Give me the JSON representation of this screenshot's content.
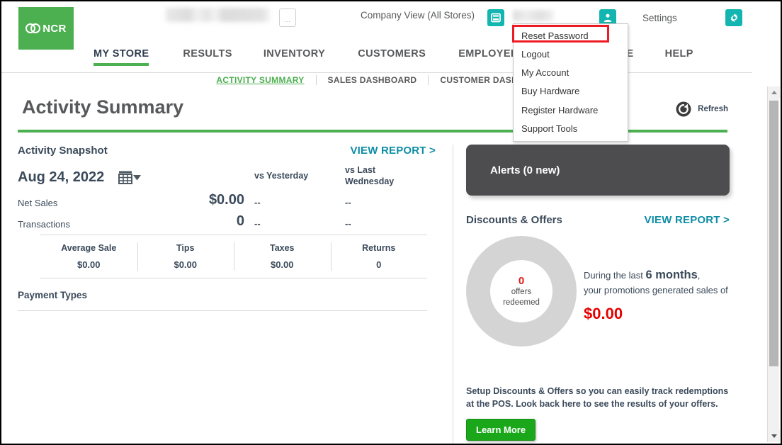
{
  "brand": {
    "logo_text": "NCR",
    "logo_color": "#4caf50"
  },
  "topbar": {
    "ellipsis_label": "...",
    "company_view": "Company View (All Stores)",
    "settings_label": "Settings",
    "store_icon": "store-icon",
    "user_icon": "user-icon",
    "gear_icon": "gear-icon"
  },
  "mainnav": {
    "items": [
      {
        "label": "MY STORE",
        "active": true
      },
      {
        "label": "RESULTS",
        "active": false
      },
      {
        "label": "INVENTORY",
        "active": false
      },
      {
        "label": "CUSTOMERS",
        "active": false
      },
      {
        "label": "EMPLOYEES",
        "active": false
      },
      {
        "label": "MAINTENANCE",
        "active": false
      },
      {
        "label": "HELP",
        "active": false
      }
    ]
  },
  "subnav": {
    "items": [
      {
        "label": "ACTIVITY SUMMARY",
        "active": true
      },
      {
        "label": "SALES DASHBOARD",
        "active": false
      },
      {
        "label": "CUSTOMER DASHBOARD",
        "active": false
      }
    ]
  },
  "page": {
    "title": "Activity Summary",
    "refresh_label": "Refresh",
    "accent_green": "#4caf50"
  },
  "snapshot": {
    "title": "Activity Snapshot",
    "view_report": "VIEW REPORT >",
    "date": "Aug 24, 2022",
    "compare_col_1": "vs Yesterday",
    "compare_col_2": "vs Last Wednesday",
    "rows": [
      {
        "label": "Net Sales",
        "value": "$0.00",
        "vs_yesterday": "--",
        "vs_last": "--"
      },
      {
        "label": "Transactions",
        "value": "0",
        "vs_yesterday": "--",
        "vs_last": "--"
      }
    ],
    "kpis": [
      {
        "name": "Average Sale",
        "value": "$0.00"
      },
      {
        "name": "Tips",
        "value": "$0.00"
      },
      {
        "name": "Taxes",
        "value": "$0.00"
      },
      {
        "name": "Returns",
        "value": "0"
      }
    ],
    "payment_types": "Payment Types"
  },
  "alerts": {
    "title": "Alerts (0 new)"
  },
  "discounts": {
    "title": "Discounts & Offers",
    "view_report": "VIEW REPORT >",
    "donut_number": "0",
    "donut_caption_line1": "offers",
    "donut_caption_line2": "redeemed",
    "promo_prefix": "During the last ",
    "promo_period": "6 months",
    "promo_suffix": ",",
    "promo_line2": "your promotions generated sales of",
    "promo_amount": "$0.00",
    "promo_amount_color": "#e80000",
    "setup_line1": "Setup Discounts & Offers so you can easily track redemptions",
    "setup_line2": "at the POS. Look back here to see the results of your offers.",
    "learn_more": "Learn More"
  },
  "dropdown": {
    "items": [
      {
        "label": "Reset Password",
        "highlighted": true
      },
      {
        "label": "Logout",
        "highlighted": false
      },
      {
        "label": "My Account",
        "highlighted": false
      },
      {
        "label": "Buy Hardware",
        "highlighted": false
      },
      {
        "label": "Register Hardware",
        "highlighted": false
      },
      {
        "label": "Support Tools",
        "highlighted": false
      }
    ],
    "highlight_color": "#ee1b24"
  }
}
